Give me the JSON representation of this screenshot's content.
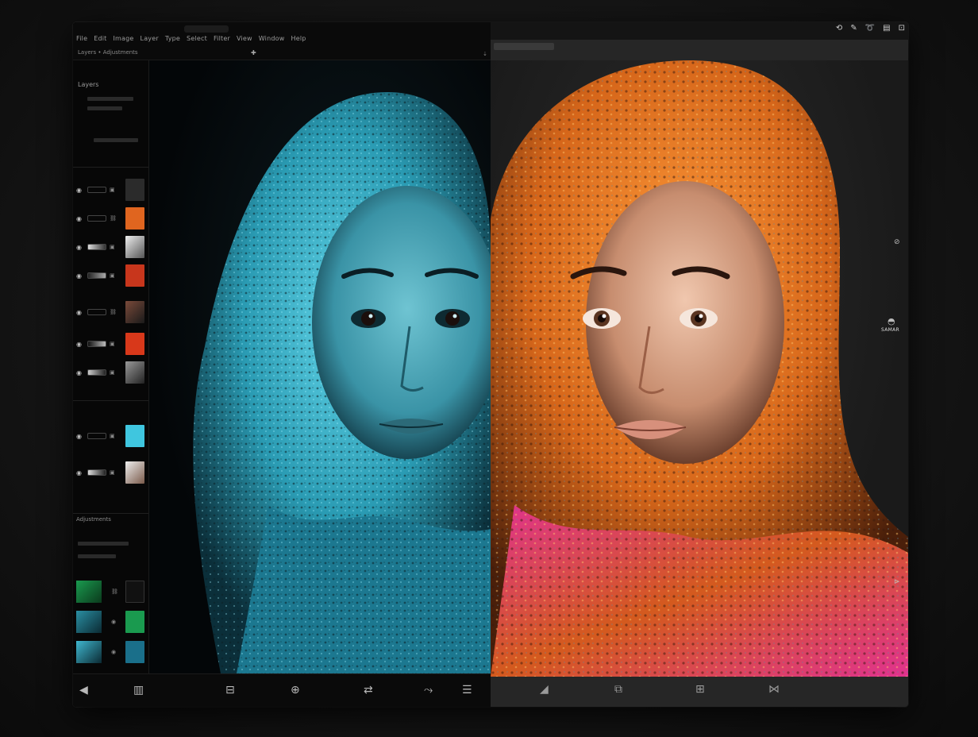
{
  "window": {
    "menu": [
      "File",
      "Edit",
      "Image",
      "Layer",
      "Type",
      "Select",
      "Filter",
      "View",
      "Window",
      "Help"
    ],
    "status_left": "Layers • Adjustments",
    "right_side_label": "SAMAR"
  },
  "layers_panel": {
    "title": "Layers",
    "section_label": "Adjustments"
  },
  "icons": {
    "add": "plus-icon",
    "pin": "pin-icon",
    "eye": "eye-icon",
    "lock": "lock-icon",
    "link": "link-icon",
    "zoom": "zoom-icon",
    "grid": "grid-icon",
    "compare": "compare-icon"
  },
  "colors": {
    "teal_scarf": "#3fb7cf",
    "orange_scarf": "#e07a1c",
    "magenta_scarf": "#e0328f",
    "skin_teal": "#4aa7b8",
    "skin_warm": "#d9a58a",
    "swatch_orange": "#e0651f",
    "swatch_red": "#c8361c",
    "swatch_cyan": "#3fc6df",
    "swatch_green": "#1a9a4f"
  }
}
